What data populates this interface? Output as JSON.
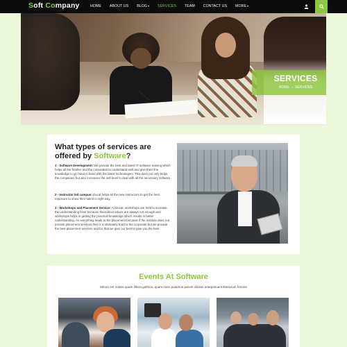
{
  "brand": {
    "logo_part1": "S",
    "logo_part2": "oft ",
    "logo_part3": "Co",
    "logo_part4": "mpany",
    "accent_color": "#8dc63f"
  },
  "nav": {
    "items": [
      {
        "label": "HOME"
      },
      {
        "label": "ABOUT US"
      },
      {
        "label": "BLOG"
      },
      {
        "label": "SERVICES"
      },
      {
        "label": "TEAM"
      },
      {
        "label": "CONTACT US"
      },
      {
        "label": "MORE"
      }
    ],
    "icons": {
      "user": "user-icon",
      "search": "search-icon"
    }
  },
  "hero": {
    "title": "SERVICES",
    "breadcrumb_home": "HOME",
    "breadcrumb_sep": "»",
    "breadcrumb_current": "SERVICES"
  },
  "services": {
    "heading_part1": "What types of services are offered by ",
    "heading_accent": "Software",
    "heading_end": "?",
    "p1_label": "1 - Software Development:",
    "p1_text": " We provide the best and latest IT software training which helps all the fresher and the corporates to understand well and give them the knowledge to go hand in hand with the latest technologies. This does not only helps the companies but also increases the self-level to deal with all the necessary software.",
    "p2_label": "2 - Instructor led campus:",
    "p2_text": " Ducat helps all the new instructors to get the best exposure to show their talent in right way.",
    "p3_label": "3 - Workshops and Placement Service:",
    "p3_text": " At Ducat, workshops are held to increase the understanding level because theoretical values are always not enough and workshops helps in getting the practical knowledge which results in better understanding. As everything leads to the placement because if the institute does not provide placement services then it is ultimately bad for the corporate but we provide the best placement services and for that we give our best to give you the best."
  },
  "events": {
    "title": "Events At Software",
    "subtitle": "Mirum est notare quam littera gothica, quam nunc putamus parum claram anteposuerit litterarum formas"
  }
}
